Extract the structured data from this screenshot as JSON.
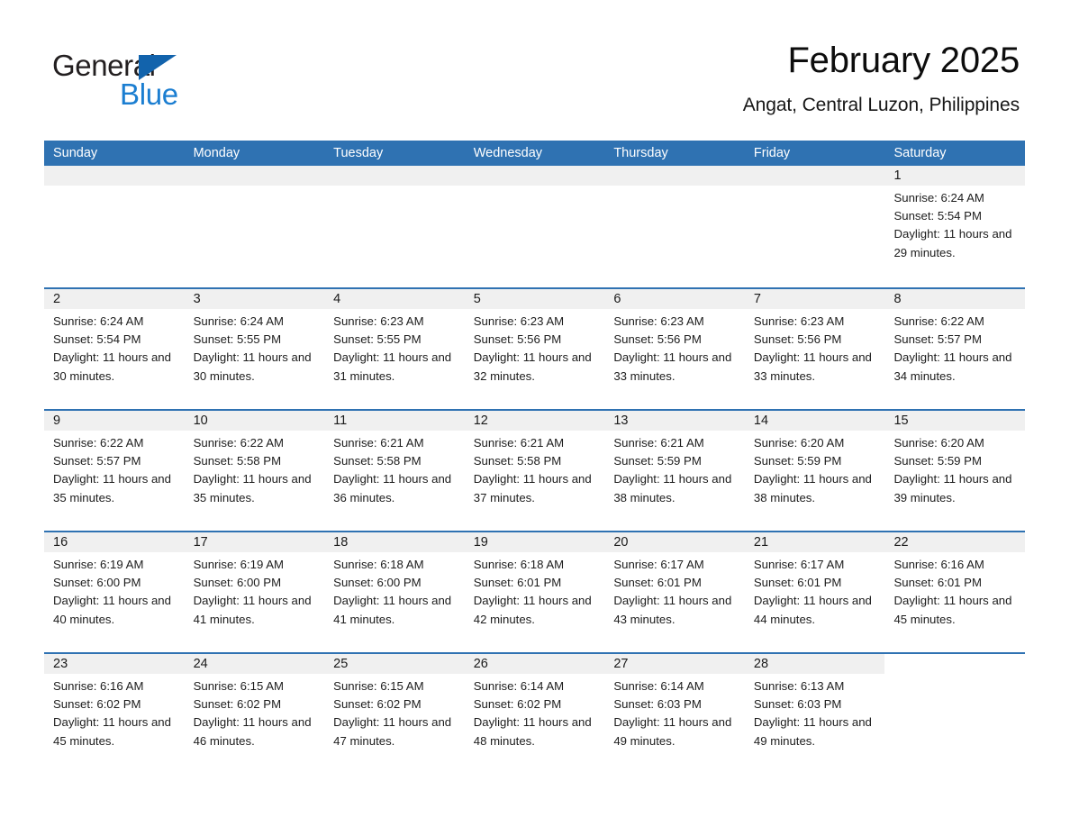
{
  "brand": {
    "name_top": "General",
    "name_bottom": "Blue",
    "triangle_color": "#1263ac",
    "blue_text_color": "#1b7ed1"
  },
  "header": {
    "title": "February 2025",
    "location": "Angat, Central Luzon, Philippines"
  },
  "theme": {
    "header_blue": "#2f72b2",
    "row_divider_blue": "#2f72b2",
    "daynum_band_gray": "#f0f0f0",
    "text": "#1a1a1a",
    "page_background": "#ffffff"
  },
  "calendar": {
    "day_headers": [
      "Sunday",
      "Monday",
      "Tuesday",
      "Wednesday",
      "Thursday",
      "Friday",
      "Saturday"
    ],
    "weeks": [
      {
        "band_span_columns": 7,
        "cells": [
          {
            "day": "",
            "info": ""
          },
          {
            "day": "",
            "info": ""
          },
          {
            "day": "",
            "info": ""
          },
          {
            "day": "",
            "info": ""
          },
          {
            "day": "",
            "info": ""
          },
          {
            "day": "",
            "info": ""
          },
          {
            "day": "1",
            "info": "Sunrise: 6:24 AM\nSunset: 5:54 PM\nDaylight: 11 hours and 29 minutes.",
            "sunrise": "6:24 AM",
            "sunset": "5:54 PM",
            "daylight": "11 hours and 29 minutes"
          }
        ]
      },
      {
        "band_span_columns": 7,
        "cells": [
          {
            "day": "2",
            "info": "Sunrise: 6:24 AM\nSunset: 5:54 PM\nDaylight: 11 hours and 30 minutes.",
            "sunrise": "6:24 AM",
            "sunset": "5:54 PM",
            "daylight": "11 hours and 30 minutes"
          },
          {
            "day": "3",
            "info": "Sunrise: 6:24 AM\nSunset: 5:55 PM\nDaylight: 11 hours and 30 minutes.",
            "sunrise": "6:24 AM",
            "sunset": "5:55 PM",
            "daylight": "11 hours and 30 minutes"
          },
          {
            "day": "4",
            "info": "Sunrise: 6:23 AM\nSunset: 5:55 PM\nDaylight: 11 hours and 31 minutes.",
            "sunrise": "6:23 AM",
            "sunset": "5:55 PM",
            "daylight": "11 hours and 31 minutes"
          },
          {
            "day": "5",
            "info": "Sunrise: 6:23 AM\nSunset: 5:56 PM\nDaylight: 11 hours and 32 minutes.",
            "sunrise": "6:23 AM",
            "sunset": "5:56 PM",
            "daylight": "11 hours and 32 minutes"
          },
          {
            "day": "6",
            "info": "Sunrise: 6:23 AM\nSunset: 5:56 PM\nDaylight: 11 hours and 33 minutes.",
            "sunrise": "6:23 AM",
            "sunset": "5:56 PM",
            "daylight": "11 hours and 33 minutes"
          },
          {
            "day": "7",
            "info": "Sunrise: 6:23 AM\nSunset: 5:56 PM\nDaylight: 11 hours and 33 minutes.",
            "sunrise": "6:23 AM",
            "sunset": "5:56 PM",
            "daylight": "11 hours and 33 minutes"
          },
          {
            "day": "8",
            "info": "Sunrise: 6:22 AM\nSunset: 5:57 PM\nDaylight: 11 hours and 34 minutes.",
            "sunrise": "6:22 AM",
            "sunset": "5:57 PM",
            "daylight": "11 hours and 34 minutes"
          }
        ]
      },
      {
        "band_span_columns": 7,
        "cells": [
          {
            "day": "9",
            "info": "Sunrise: 6:22 AM\nSunset: 5:57 PM\nDaylight: 11 hours and 35 minutes.",
            "sunrise": "6:22 AM",
            "sunset": "5:57 PM",
            "daylight": "11 hours and 35 minutes"
          },
          {
            "day": "10",
            "info": "Sunrise: 6:22 AM\nSunset: 5:58 PM\nDaylight: 11 hours and 35 minutes.",
            "sunrise": "6:22 AM",
            "sunset": "5:58 PM",
            "daylight": "11 hours and 35 minutes"
          },
          {
            "day": "11",
            "info": "Sunrise: 6:21 AM\nSunset: 5:58 PM\nDaylight: 11 hours and 36 minutes.",
            "sunrise": "6:21 AM",
            "sunset": "5:58 PM",
            "daylight": "11 hours and 36 minutes"
          },
          {
            "day": "12",
            "info": "Sunrise: 6:21 AM\nSunset: 5:58 PM\nDaylight: 11 hours and 37 minutes.",
            "sunrise": "6:21 AM",
            "sunset": "5:58 PM",
            "daylight": "11 hours and 37 minutes"
          },
          {
            "day": "13",
            "info": "Sunrise: 6:21 AM\nSunset: 5:59 PM\nDaylight: 11 hours and 38 minutes.",
            "sunrise": "6:21 AM",
            "sunset": "5:59 PM",
            "daylight": "11 hours and 38 minutes"
          },
          {
            "day": "14",
            "info": "Sunrise: 6:20 AM\nSunset: 5:59 PM\nDaylight: 11 hours and 38 minutes.",
            "sunrise": "6:20 AM",
            "sunset": "5:59 PM",
            "daylight": "11 hours and 38 minutes"
          },
          {
            "day": "15",
            "info": "Sunrise: 6:20 AM\nSunset: 5:59 PM\nDaylight: 11 hours and 39 minutes.",
            "sunrise": "6:20 AM",
            "sunset": "5:59 PM",
            "daylight": "11 hours and 39 minutes"
          }
        ]
      },
      {
        "band_span_columns": 7,
        "cells": [
          {
            "day": "16",
            "info": "Sunrise: 6:19 AM\nSunset: 6:00 PM\nDaylight: 11 hours and 40 minutes.",
            "sunrise": "6:19 AM",
            "sunset": "6:00 PM",
            "daylight": "11 hours and 40 minutes"
          },
          {
            "day": "17",
            "info": "Sunrise: 6:19 AM\nSunset: 6:00 PM\nDaylight: 11 hours and 41 minutes.",
            "sunrise": "6:19 AM",
            "sunset": "6:00 PM",
            "daylight": "11 hours and 41 minutes"
          },
          {
            "day": "18",
            "info": "Sunrise: 6:18 AM\nSunset: 6:00 PM\nDaylight: 11 hours and 41 minutes.",
            "sunrise": "6:18 AM",
            "sunset": "6:00 PM",
            "daylight": "11 hours and 41 minutes"
          },
          {
            "day": "19",
            "info": "Sunrise: 6:18 AM\nSunset: 6:01 PM\nDaylight: 11 hours and 42 minutes.",
            "sunrise": "6:18 AM",
            "sunset": "6:01 PM",
            "daylight": "11 hours and 42 minutes"
          },
          {
            "day": "20",
            "info": "Sunrise: 6:17 AM\nSunset: 6:01 PM\nDaylight: 11 hours and 43 minutes.",
            "sunrise": "6:17 AM",
            "sunset": "6:01 PM",
            "daylight": "11 hours and 43 minutes"
          },
          {
            "day": "21",
            "info": "Sunrise: 6:17 AM\nSunset: 6:01 PM\nDaylight: 11 hours and 44 minutes.",
            "sunrise": "6:17 AM",
            "sunset": "6:01 PM",
            "daylight": "11 hours and 44 minutes"
          },
          {
            "day": "22",
            "info": "Sunrise: 6:16 AM\nSunset: 6:01 PM\nDaylight: 11 hours and 45 minutes.",
            "sunrise": "6:16 AM",
            "sunset": "6:01 PM",
            "daylight": "11 hours and 45 minutes"
          }
        ]
      },
      {
        "band_span_columns": 6,
        "cells": [
          {
            "day": "23",
            "info": "Sunrise: 6:16 AM\nSunset: 6:02 PM\nDaylight: 11 hours and 45 minutes.",
            "sunrise": "6:16 AM",
            "sunset": "6:02 PM",
            "daylight": "11 hours and 45 minutes"
          },
          {
            "day": "24",
            "info": "Sunrise: 6:15 AM\nSunset: 6:02 PM\nDaylight: 11 hours and 46 minutes.",
            "sunrise": "6:15 AM",
            "sunset": "6:02 PM",
            "daylight": "11 hours and 46 minutes"
          },
          {
            "day": "25",
            "info": "Sunrise: 6:15 AM\nSunset: 6:02 PM\nDaylight: 11 hours and 47 minutes.",
            "sunrise": "6:15 AM",
            "sunset": "6:02 PM",
            "daylight": "11 hours and 47 minutes"
          },
          {
            "day": "26",
            "info": "Sunrise: 6:14 AM\nSunset: 6:02 PM\nDaylight: 11 hours and 48 minutes.",
            "sunrise": "6:14 AM",
            "sunset": "6:02 PM",
            "daylight": "11 hours and 48 minutes"
          },
          {
            "day": "27",
            "info": "Sunrise: 6:14 AM\nSunset: 6:03 PM\nDaylight: 11 hours and 49 minutes.",
            "sunrise": "6:14 AM",
            "sunset": "6:03 PM",
            "daylight": "11 hours and 49 minutes"
          },
          {
            "day": "28",
            "info": "Sunrise: 6:13 AM\nSunset: 6:03 PM\nDaylight: 11 hours and 49 minutes.",
            "sunrise": "6:13 AM",
            "sunset": "6:03 PM",
            "daylight": "11 hours and 49 minutes"
          },
          {
            "day": "",
            "info": ""
          }
        ]
      }
    ]
  }
}
